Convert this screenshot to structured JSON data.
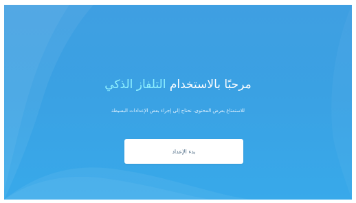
{
  "welcome": {
    "title_prefix": "مرحبًا بالاستخدام",
    "title_accent": "التلفاز الذكي",
    "subtitle": "للاستمتاع بعرض المحتوى، نحتاج إلى إجراء بعض الإعدادات البسيطة"
  },
  "actions": {
    "start_setup_label": "بدء الإعداد"
  },
  "colors": {
    "background_blue": "#3aa1e3",
    "accent_cyan": "#8ef0ff",
    "button_background": "#ffffff"
  }
}
